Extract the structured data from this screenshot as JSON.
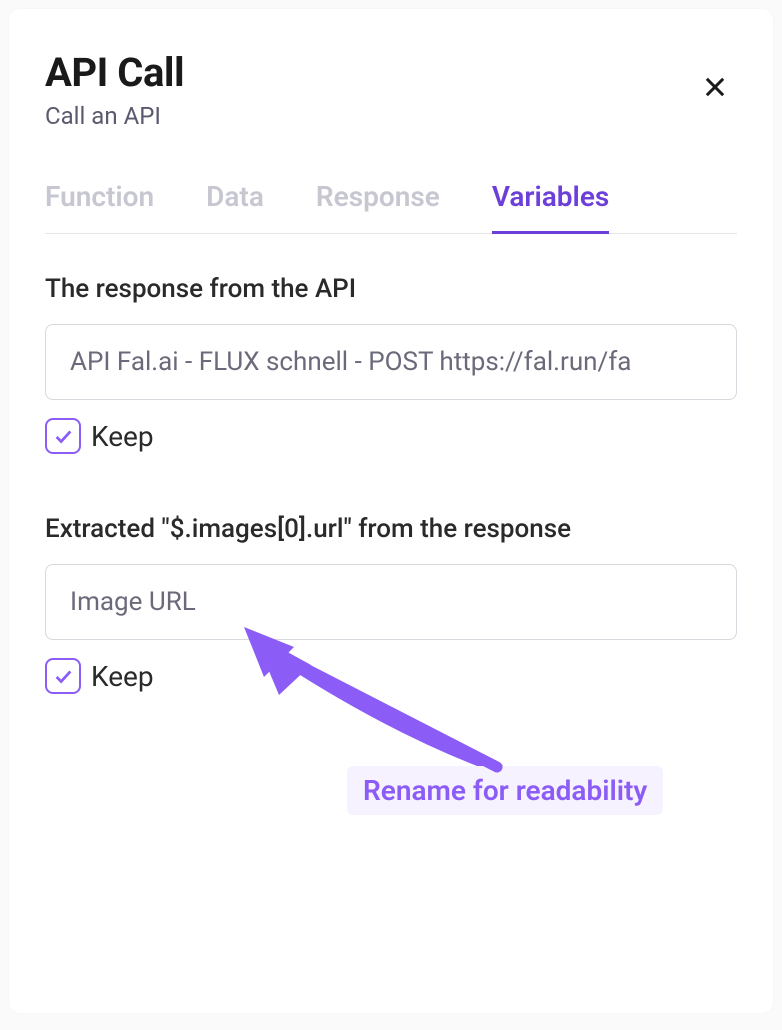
{
  "header": {
    "title": "API Call",
    "subtitle": "Call an API"
  },
  "tabs": [
    {
      "label": "Function",
      "active": false
    },
    {
      "label": "Data",
      "active": false
    },
    {
      "label": "Response",
      "active": false
    },
    {
      "label": "Variables",
      "active": true
    }
  ],
  "sections": {
    "response": {
      "label": "The response from the API",
      "value": "API Fal.ai - FLUX schnell - POST https://fal.run/fa",
      "keep_label": "Keep",
      "keep_checked": true
    },
    "extracted": {
      "label": "Extracted \"$.images[0].url\" from the response",
      "value": "Image URL",
      "keep_label": "Keep",
      "keep_checked": true
    }
  },
  "annotation": {
    "callout": "Rename for readability"
  }
}
